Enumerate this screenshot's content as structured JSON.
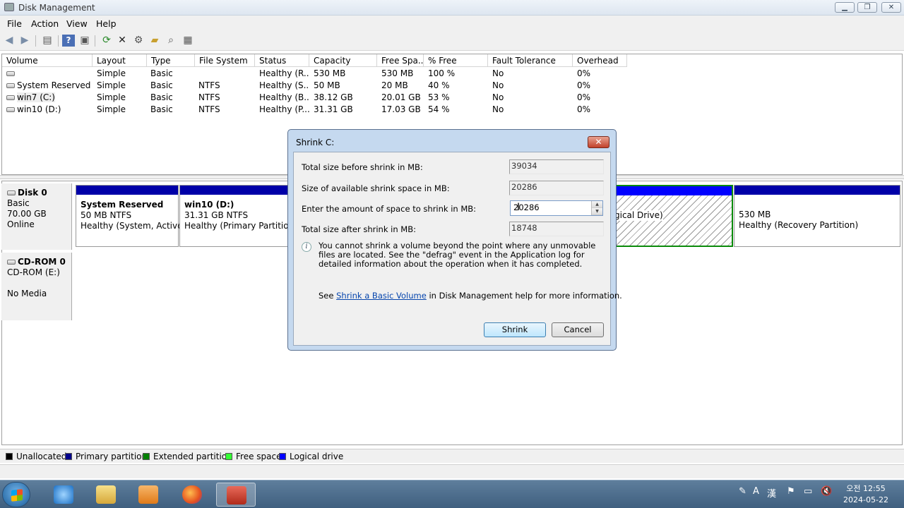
{
  "window": {
    "title": "Disk Management",
    "min": "▁",
    "max": "❐",
    "close": "✕"
  },
  "menu": [
    "File",
    "Action",
    "View",
    "Help"
  ],
  "toolbar_icons": [
    "back-icon",
    "forward-icon",
    "console-tree-icon",
    "help-icon",
    "properties-icon",
    "refresh-icon",
    "delete-icon",
    "settings-icon",
    "open-icon",
    "search-icon",
    "disk-icon"
  ],
  "columns": [
    "Volume",
    "Layout",
    "Type",
    "File System",
    "Status",
    "Capacity",
    "Free Spa...",
    "% Free",
    "Fault Tolerance",
    "Overhead"
  ],
  "volumes": [
    [
      "",
      "Simple",
      "Basic",
      "",
      "Healthy (R...",
      "530 MB",
      "530 MB",
      "100 %",
      "No",
      "0%"
    ],
    [
      "System Reserved",
      "Simple",
      "Basic",
      "NTFS",
      "Healthy (S...",
      "50 MB",
      "20 MB",
      "40 %",
      "No",
      "0%"
    ],
    [
      "win7 (C:)",
      "Simple",
      "Basic",
      "NTFS",
      "Healthy (B...",
      "38.12 GB",
      "20.01 GB",
      "53 %",
      "No",
      "0%"
    ],
    [
      "win10 (D:)",
      "Simple",
      "Basic",
      "NTFS",
      "Healthy (P...",
      "31.31 GB",
      "17.03 GB",
      "54 %",
      "No",
      "0%"
    ]
  ],
  "disk0": {
    "name": "Disk 0",
    "type": "Basic",
    "size": "70.00 GB",
    "status": "Online"
  },
  "cdrom": {
    "name": "CD-ROM 0",
    "drive": "CD-ROM (E:)",
    "media": "No Media"
  },
  "partitions": {
    "sysres": {
      "name": "System Reserved",
      "size": "50 MB NTFS",
      "status": "Healthy (System, Active,"
    },
    "win10": {
      "name": "win10  (D:)",
      "size": "31.31 GB NTFS",
      "status": "Healthy (Primary Partition)"
    },
    "logical": {
      "status": "gical Drive)"
    },
    "recovery": {
      "size": "530 MB",
      "status": "Healthy (Recovery Partition)"
    }
  },
  "legend": [
    {
      "label": "Unallocated",
      "color": "#000000"
    },
    {
      "label": "Primary partition",
      "color": "#00008b"
    },
    {
      "label": "Extended partition",
      "color": "#008000"
    },
    {
      "label": "Free space",
      "color": "#33ff33"
    },
    {
      "label": "Logical drive",
      "color": "#0000ff"
    }
  ],
  "dialog": {
    "title": "Shrink C:",
    "close": "✕",
    "total_before_label": "Total size before shrink in MB:",
    "total_before_value": "39034",
    "available_label": "Size of available shrink space in MB:",
    "available_value": "20286",
    "amount_label": "Enter the amount of space to shrink in MB:",
    "amount_value": "20286",
    "total_after_label": "Total size after shrink in MB:",
    "total_after_value": "18748",
    "info_icon": "i",
    "info_text": "You cannot shrink a volume beyond the point where any unmovable files are located. See the \"defrag\" event in the Application log for detailed information about the operation when it has completed.",
    "see_prefix": "See ",
    "see_link": "Shrink a Basic Volume",
    "see_suffix": " in Disk Management help for more information.",
    "shrink_button": "Shrink",
    "cancel_button": "Cancel"
  },
  "tray": {
    "ime": "A",
    "hanja": "漢",
    "time": "오전 12:55",
    "date": "2024-05-22"
  }
}
